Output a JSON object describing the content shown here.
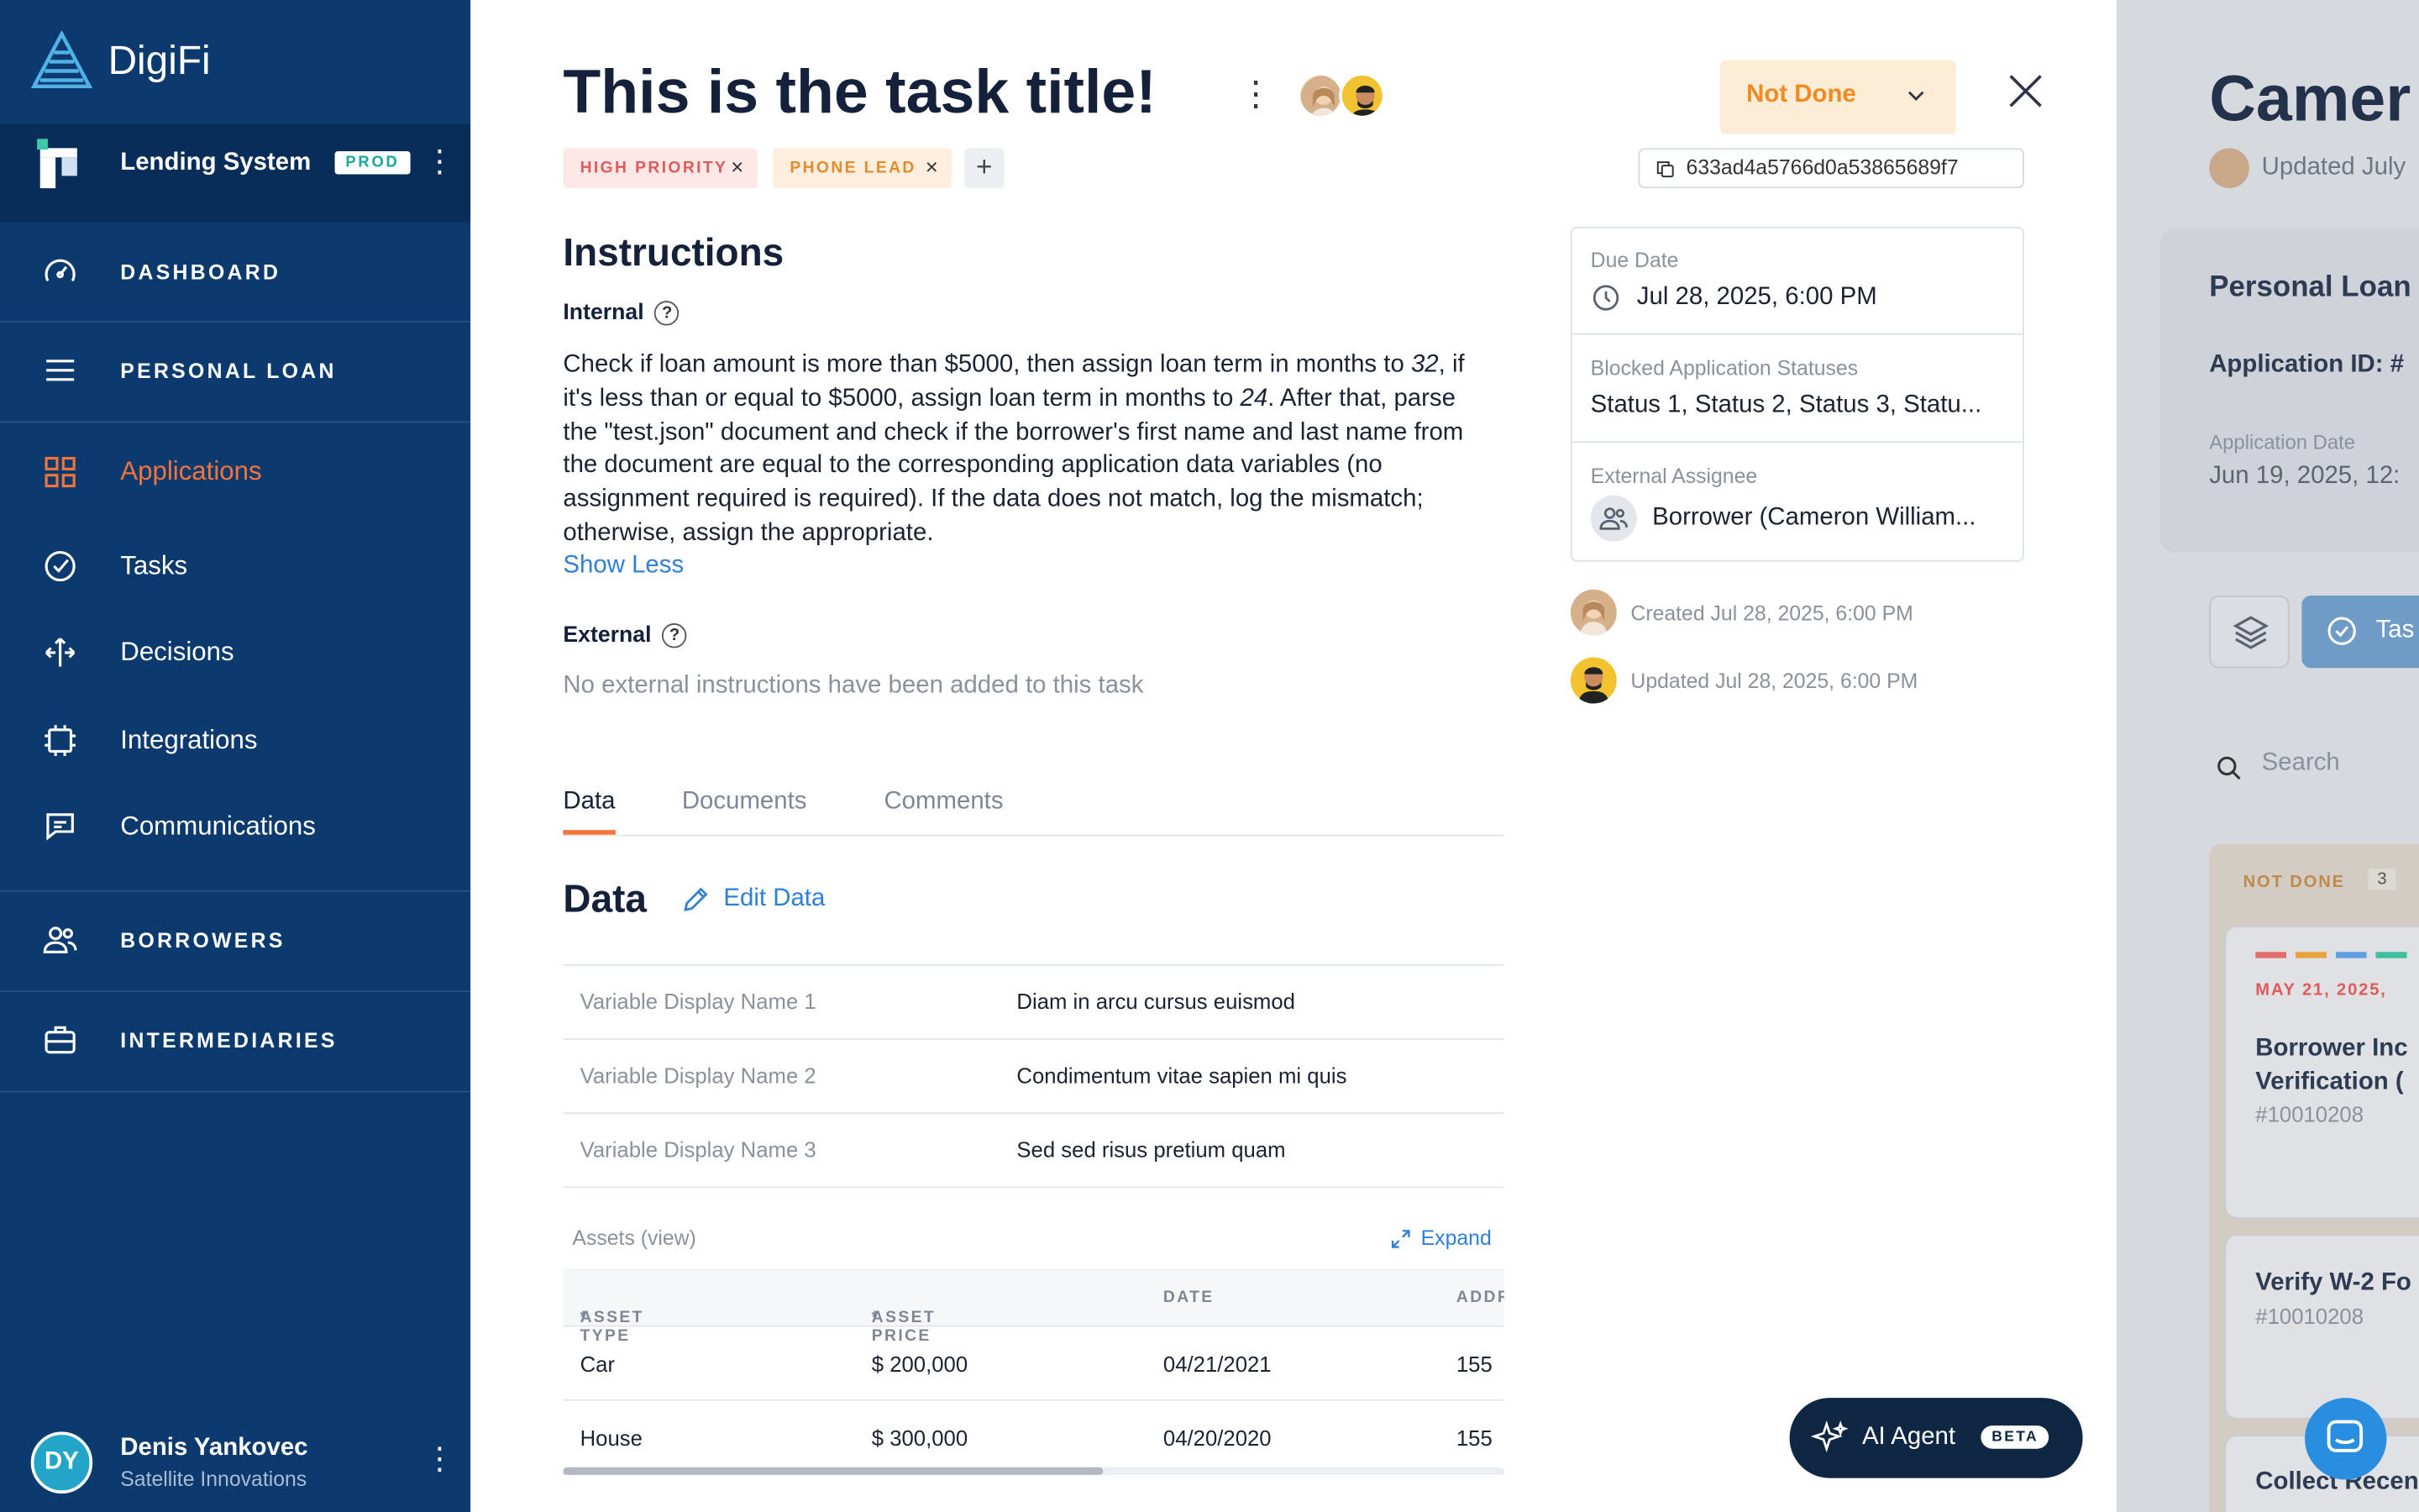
{
  "sidebar": {
    "logo_text": "DigiFi",
    "org": {
      "name": "Lending System",
      "badge": "PROD"
    },
    "nav": [
      {
        "label": "DASHBOARD",
        "icon": "gauge-icon"
      },
      {
        "label": "PERSONAL LOAN",
        "icon": "hamburger-icon"
      },
      {
        "label": "Applications",
        "icon": "grid-icon",
        "active": true
      },
      {
        "label": "Tasks",
        "icon": "check-circle-icon"
      },
      {
        "label": "Decisions",
        "icon": "split-arrows-icon"
      },
      {
        "label": "Integrations",
        "icon": "chip-icon"
      },
      {
        "label": "Communications",
        "icon": "chat-icon"
      },
      {
        "label": "BORROWERS",
        "icon": "users-icon"
      },
      {
        "label": "INTERMEDIARIES",
        "icon": "briefcase-icon"
      }
    ],
    "user": {
      "initials": "DY",
      "name": "Denis Yankovec",
      "org": "Satellite Innovations"
    }
  },
  "task": {
    "title": "This is the task title!",
    "status": "Not Done",
    "tags": [
      "HIGH PRIORITY",
      "PHONE LEAD"
    ],
    "id": "633ad4a5766d0a53865689f7",
    "instructions_heading": "Instructions",
    "internal_label": "Internal",
    "internal_text_1": "Check if loan amount is more than $5000, then assign loan term in months to ",
    "internal_em_1": "32",
    "internal_text_2": ", if it's less than or equal to $5000, assign loan term in months to ",
    "internal_em_2": "24",
    "internal_text_3": ". After that, parse the \"test.json\" document and check if the borrower's first name and last name from the document are equal to the corresponding application data variables (no assignment required is required). If the data does not match, log the mismatch; otherwise, assign the appropriate.",
    "show_less": "Show Less",
    "external_label": "External",
    "external_text": "No external instructions have been added to this task"
  },
  "tabs": [
    "Data",
    "Documents",
    "Comments"
  ],
  "data_section": {
    "heading": "Data",
    "edit_label": "Edit Data",
    "variables": [
      {
        "name": "Variable Display Name 1",
        "value": "Diam in arcu cursus euismod"
      },
      {
        "name": "Variable Display Name 2",
        "value": "Condimentum vitae sapien mi quis"
      },
      {
        "name": "Variable Display Name 3",
        "value": "Sed sed risus pretium quam"
      }
    ],
    "assets_label": "Assets (view)",
    "expand_label": "Expand",
    "asset_columns": [
      "ASSET TYPE",
      "ASSET PRICE",
      "DATE",
      "ADDR"
    ],
    "assets": [
      {
        "type": "Car",
        "price": "$ 200,000",
        "date": "04/21/2021",
        "addr": "155"
      },
      {
        "type": "House",
        "price": "$ 300,000",
        "date": "04/20/2020",
        "addr": "155"
      }
    ]
  },
  "details": {
    "due_label": "Due Date",
    "due_value": "Jul 28, 2025, 6:00 PM",
    "blocked_label": "Blocked Application Statuses",
    "blocked_value": "Status 1, Status 2, Status 3, Statu...",
    "assignee_label": "External Assignee",
    "assignee_value": "Borrower (Cameron William...",
    "created": "Created Jul 28, 2025, 6:00 PM",
    "updated": "Updated Jul 28, 2025, 6:00 PM"
  },
  "ai_agent": {
    "label": "AI Agent",
    "badge": "BETA"
  },
  "background": {
    "title": "Camer",
    "updated": "Updated July",
    "card_title": "Personal Loan",
    "app_id": "Application ID: #",
    "app_date_label": "Application Date",
    "app_date": "Jun 19, 2025, 12:",
    "tasks_btn": "Tas",
    "search": "Search",
    "column": "NOT DONE",
    "column_count": "3",
    "card1_date": "MAY 21, 2025,",
    "card1_title_1": "Borrower Inc",
    "card1_title_2": "Verification (",
    "card1_id": "#10010208",
    "card2_title": "Verify W-2 Fo",
    "card2_id": "#10010208",
    "card3_title": "Collect Recen"
  },
  "colors": {
    "sidebar": "#0c3a6e",
    "accent": "#f4743b",
    "link": "#2f7fd8",
    "status_bg": "#fdecd6",
    "status_text": "#f28a1f"
  }
}
